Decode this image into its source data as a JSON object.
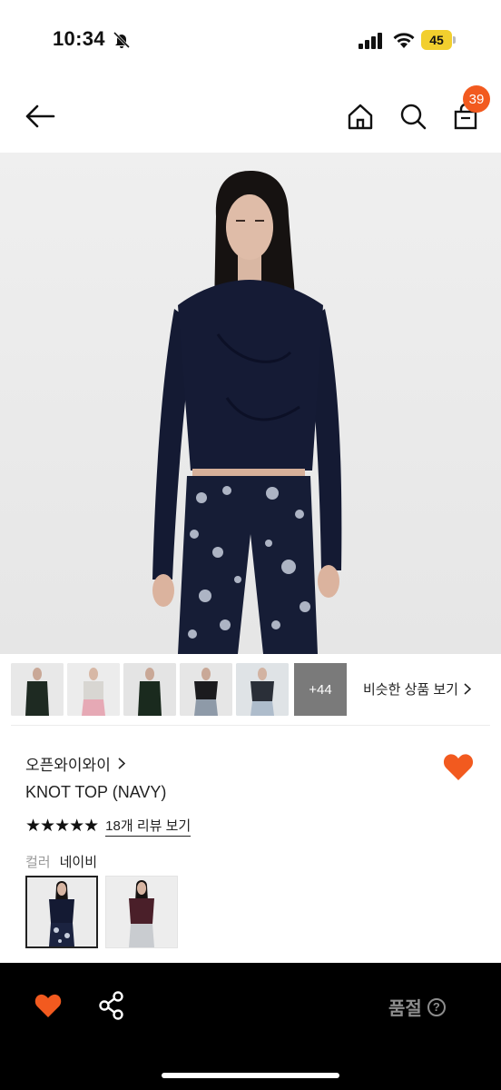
{
  "status_bar": {
    "time": "10:34",
    "battery": "45"
  },
  "header": {
    "cart_count": "39"
  },
  "thumbnails": {
    "more_count": "+44",
    "similar_label": "비슷한 상품 보기"
  },
  "product": {
    "brand": "오픈와이와이",
    "name": "KNOT TOP (NAVY)",
    "stars": "★★★★★",
    "review_link": "18개 리뷰 보기",
    "color_label": "컬러",
    "color_value": "네이비"
  },
  "bottom_bar": {
    "status": "품절",
    "help_glyph": "?"
  },
  "colors": {
    "accent": "#f25a1f",
    "navy": "#141a33",
    "burgundy": "#4a1f29"
  }
}
